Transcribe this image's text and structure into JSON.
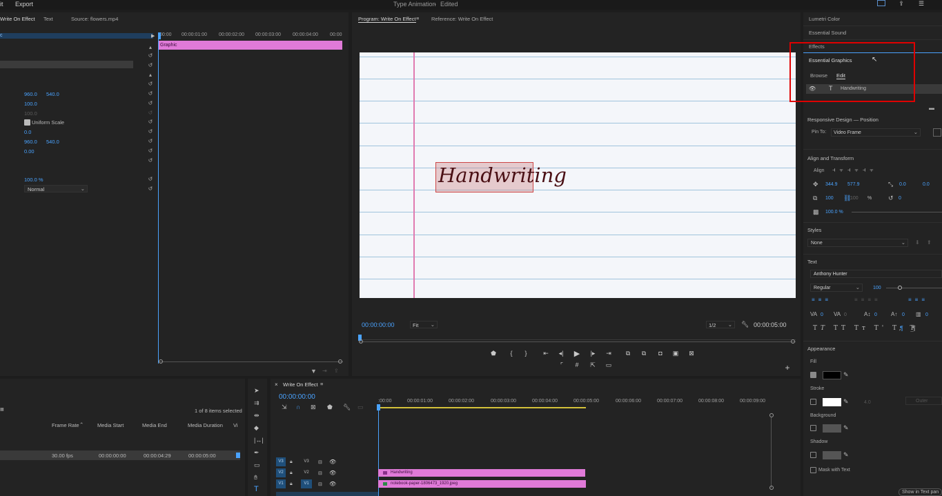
{
  "topbar": {
    "menu_edit": "it",
    "menu_export": "Export",
    "title": "Type Animation",
    "title_sep": " - ",
    "title_status": "Edited"
  },
  "effect_controls": {
    "tabs": {
      "effect_controls": "Write On Effect",
      "text": "Text",
      "source": "Source: flowers.mp4"
    },
    "fx_label": "c",
    "timeline_ticks": [
      "00:00",
      "00:00:01:00",
      "00:00:02:00",
      "00:00:03:00",
      "00:00:04:00",
      "00:00"
    ],
    "graphic_clip": "Graphic",
    "values": {
      "pos_x": "960.0",
      "pos_y": "540.0",
      "scale": "100.0",
      "scale_width": "100.0",
      "uniform_scale": "Uniform Scale",
      "rotation": "0.0",
      "anchor_x": "960.0",
      "anchor_y": "540.0",
      "antiflicker": "0.00",
      "opacity": "100.0 %",
      "blend_mode": "Normal"
    }
  },
  "program": {
    "tabs": {
      "program": "Program: Write On Effect",
      "reference": "Reference: Write On Effect"
    },
    "timecode": "00:00:00:00",
    "fit": "Fit",
    "resolution": "1/2",
    "duration": "00:00:05:00",
    "handwriting_text": "Handwriting"
  },
  "project": {
    "items_selected": "1 of 8 items selected",
    "columns": [
      "Frame Rate",
      "Media Start",
      "Media End",
      "Media Duration",
      "Vi"
    ],
    "row": {
      "frame_rate": "30.00 fps",
      "media_start": "00:00:00:00",
      "media_end": "00:00:04:29",
      "media_duration": "00:00:05:00"
    }
  },
  "timeline": {
    "tab": "Write On Effect",
    "timecode": "00:00:00:00",
    "ticks": [
      ":00:00",
      "00:00:01:00",
      "00:00:02:00",
      "00:00:03:00",
      "00:00:04:00",
      "00:00:05:00",
      "00:00:06:00",
      "00:00:07:00",
      "00:00:08:00",
      "00:00:09:00"
    ],
    "tracks": [
      {
        "name": "V3",
        "src": "V3"
      },
      {
        "name": "V2",
        "src": "V2"
      },
      {
        "name": "V1",
        "src": "V1"
      }
    ],
    "clips": {
      "v2": "Handwriting",
      "v1": "notebook-paper-1806473_1920.jpeg"
    }
  },
  "right_panels": {
    "lumetri": "Lumetri Color",
    "sound": "Essential Sound",
    "effects": "Effects"
  },
  "essential_graphics": {
    "title": "Essential Graphics",
    "tab_browse": "Browse",
    "tab_edit": "Edit",
    "layer_name": "Handwriting",
    "responsive_title": "Responsive Design — Position",
    "pin_to_label": "Pin To:",
    "pin_to_value": "Video Frame",
    "align_title": "Align and Transform",
    "align_label": "Align",
    "pos_x": "344.9",
    "pos_y": "577.9",
    "anchor_x": "0.0",
    "anchor_y": "0.0",
    "scale": "100",
    "scale_h": "100",
    "scale_unit": "%",
    "rotation": "0",
    "opacity": "100.0 %",
    "styles_title": "Styles",
    "style_value": "None",
    "text_title": "Text",
    "font_name": "Anthony Hunter",
    "font_style": "Regular",
    "font_size": "100",
    "tracking": "0",
    "kerning": "0",
    "leading": "0",
    "baseline": "0",
    "tsume": "0",
    "appearance_title": "Appearance",
    "fill": "Fill",
    "stroke": "Stroke",
    "stroke_width": "4.0",
    "stroke_type": "Outer",
    "background": "Background",
    "shadow": "Shadow",
    "mask": "Mask with Text",
    "show_in_text": "Show in Text pan"
  },
  "colors": {
    "accent": "#4aa3ff",
    "clip_pink": "#e07ad8",
    "highlight_red": "#e00000"
  }
}
